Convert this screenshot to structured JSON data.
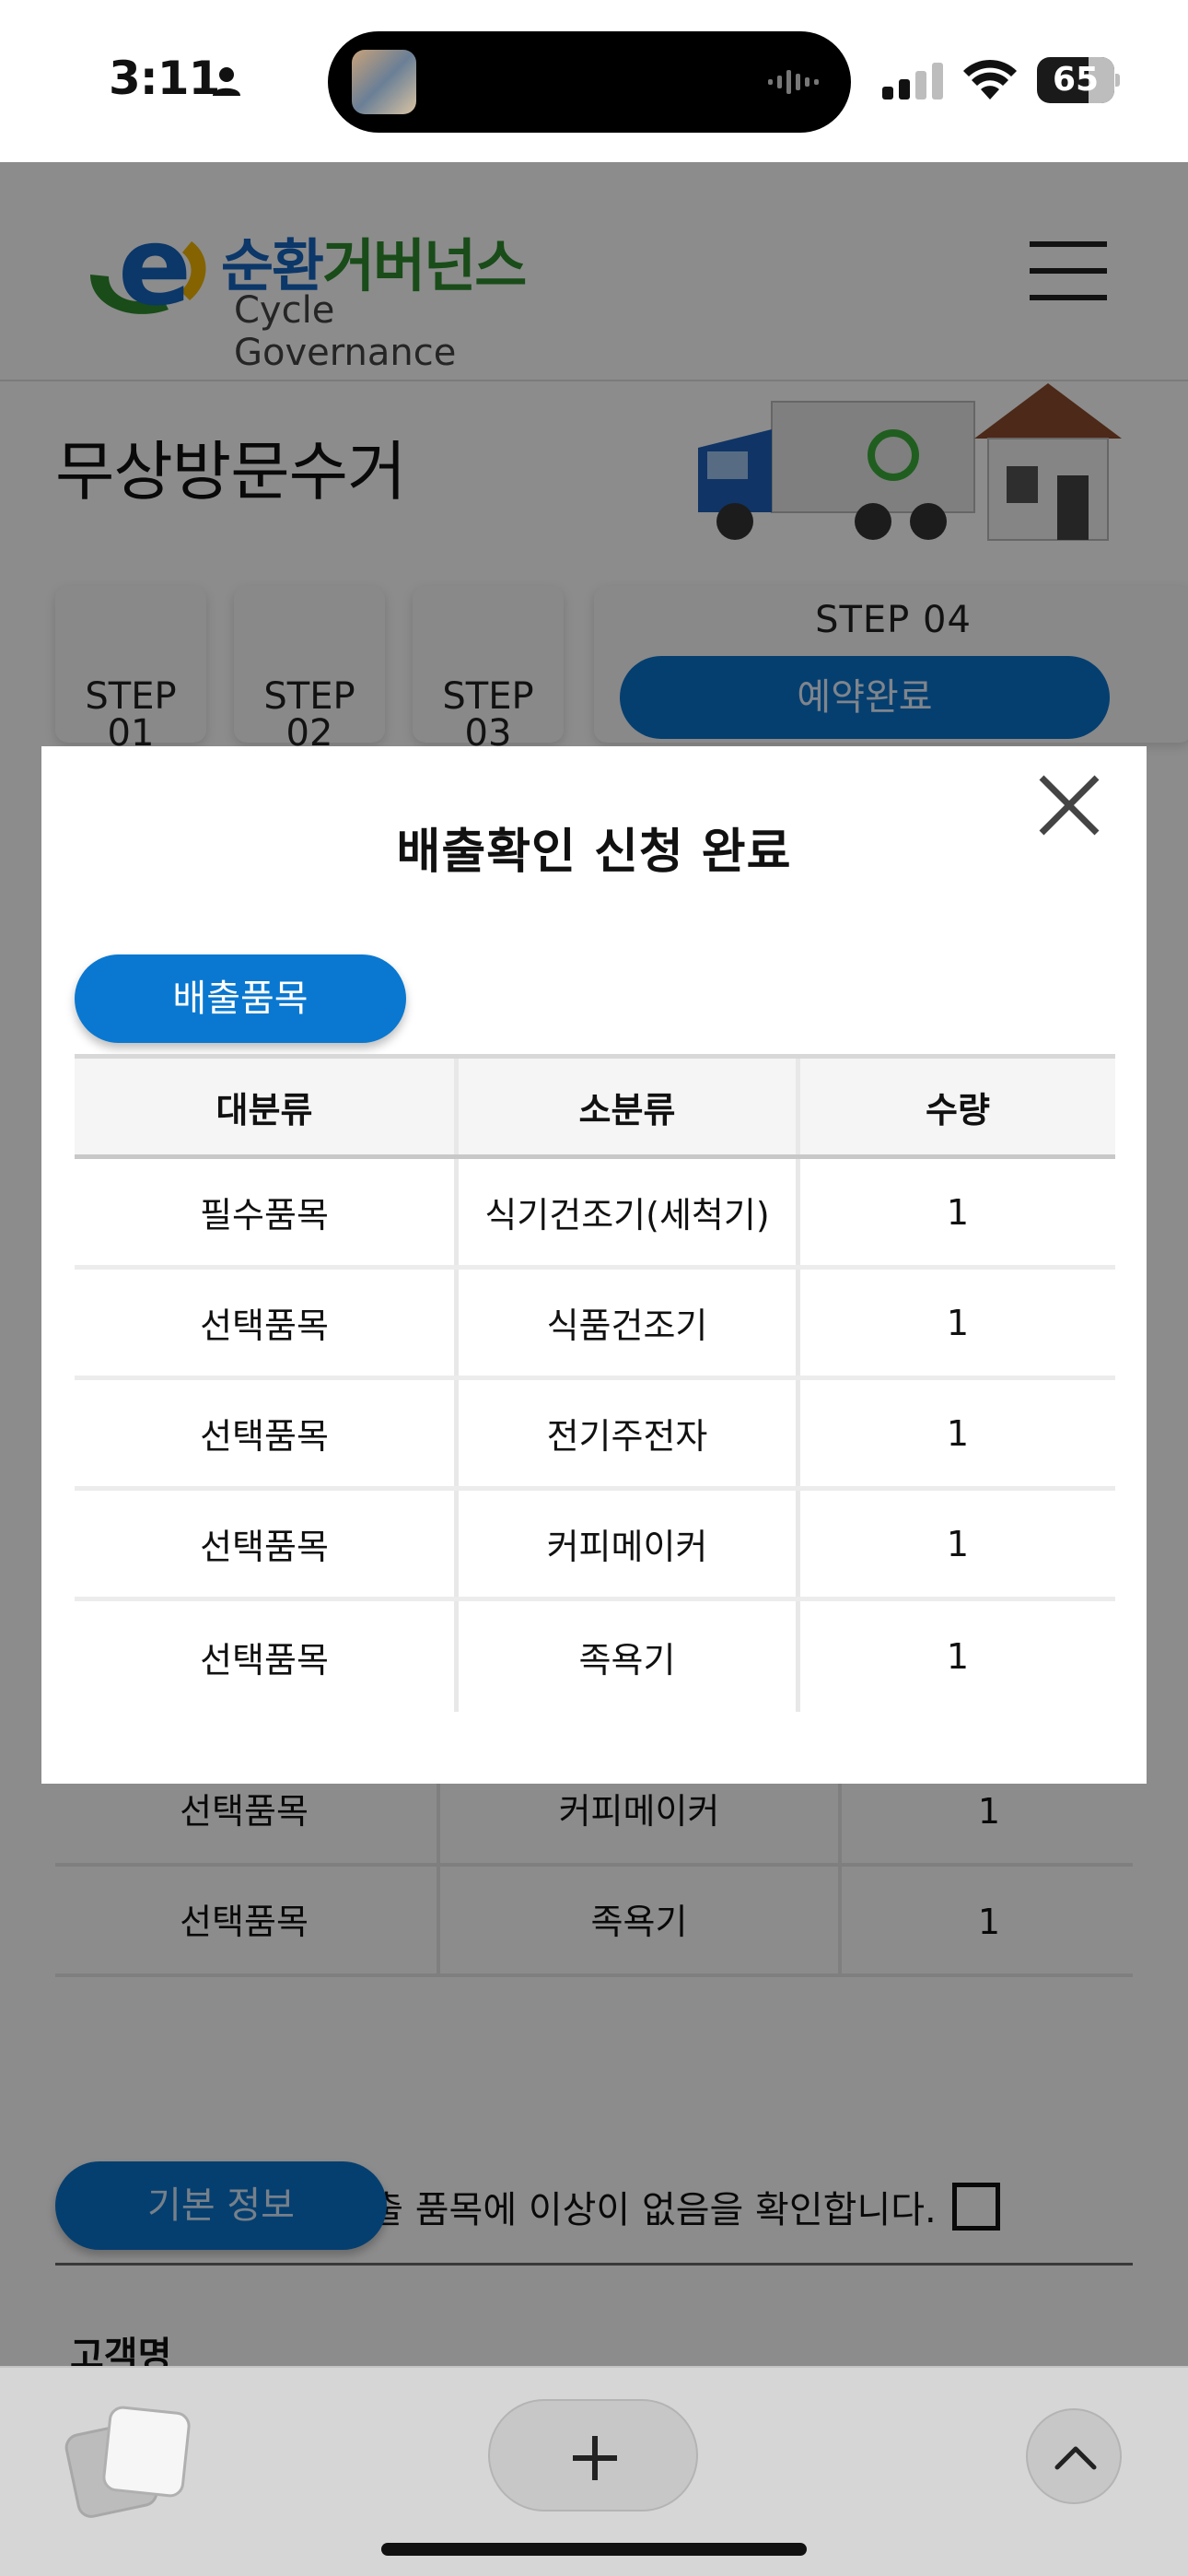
{
  "status_bar": {
    "time": "3:11",
    "battery": "65"
  },
  "header": {
    "logo_ko_part1": "순환",
    "logo_ko_part2": "거버넌스",
    "logo_en": "Cycle Governance"
  },
  "page": {
    "title": "무상방문수거",
    "steps": [
      {
        "label": "STEP",
        "num": "01"
      },
      {
        "label": "STEP",
        "num": "02"
      },
      {
        "label": "STEP",
        "num": "03"
      }
    ],
    "step4": {
      "label": "STEP 04",
      "button": "예약완료"
    },
    "background_rows": [
      {
        "category": "선택품목",
        "subcategory": "커피메이커",
        "qty": "1"
      },
      {
        "category": "선택품목",
        "subcategory": "족욕기",
        "qty": "1"
      }
    ],
    "confirm_text": "선택하신 배출 품목에 이상이 없음을 확인합니다.",
    "basic_info_button": "기본 정보",
    "customer_label": "고객명"
  },
  "modal": {
    "title": "배출확인 신청 완료",
    "section_button": "배출품목",
    "columns": [
      "대분류",
      "소분류",
      "수량"
    ],
    "rows": [
      {
        "category": "필수품목",
        "subcategory": "식기건조기(세척기)",
        "qty": "1"
      },
      {
        "category": "선택품목",
        "subcategory": "식품건조기",
        "qty": "1"
      },
      {
        "category": "선택품목",
        "subcategory": "전기주전자",
        "qty": "1"
      },
      {
        "category": "선택품목",
        "subcategory": "커피메이커",
        "qty": "1"
      },
      {
        "category": "선택품목",
        "subcategory": "족욕기",
        "qty": "1"
      }
    ]
  },
  "icons": {
    "close": "close-icon",
    "menu": "hamburger-menu-icon",
    "tabs": "tabs-icon",
    "new_tab": "plus-icon",
    "scroll_top": "chevron-up-icon"
  },
  "colors": {
    "primary": "#0a78d0",
    "overlay": "rgba(0,0,0,0.45)"
  }
}
